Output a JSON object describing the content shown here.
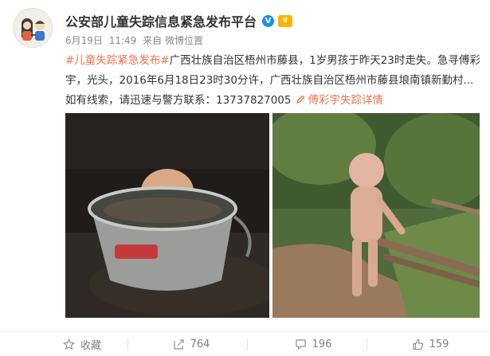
{
  "account": {
    "name": "公安部儿童失踪信息紧急发布平台",
    "verified_icon": "verified-v-icon",
    "vip_icon": "vip-crown-icon"
  },
  "meta": {
    "date": "6月19日",
    "time": "11:49",
    "source": "来自 微博位置"
  },
  "post": {
    "topic": "#儿童失踪紧急发布#",
    "body": "广西壮族自治区梧州市藤县，1岁男孩于昨天23时走失。急寻傅彩宇，光头，2016年6月18日23时30分许，广西壮族自治区梧州市藤县埌南镇新勤村...如有线索，请迅速与警方联系：13737827005",
    "link_label": "傅彩宇失踪详情",
    "link_icon": "pencil-link-icon"
  },
  "photos": [
    {
      "name": "photo-child-in-bucket",
      "icon": "photo-icon"
    },
    {
      "name": "photo-child-standing",
      "icon": "photo-icon"
    }
  ],
  "actions": {
    "favorite_label": "收藏",
    "repost_count": "764",
    "comment_count": "196",
    "like_count": "159"
  },
  "colors": {
    "accent": "#eb7350",
    "text": "#333333",
    "muted": "#808080"
  }
}
